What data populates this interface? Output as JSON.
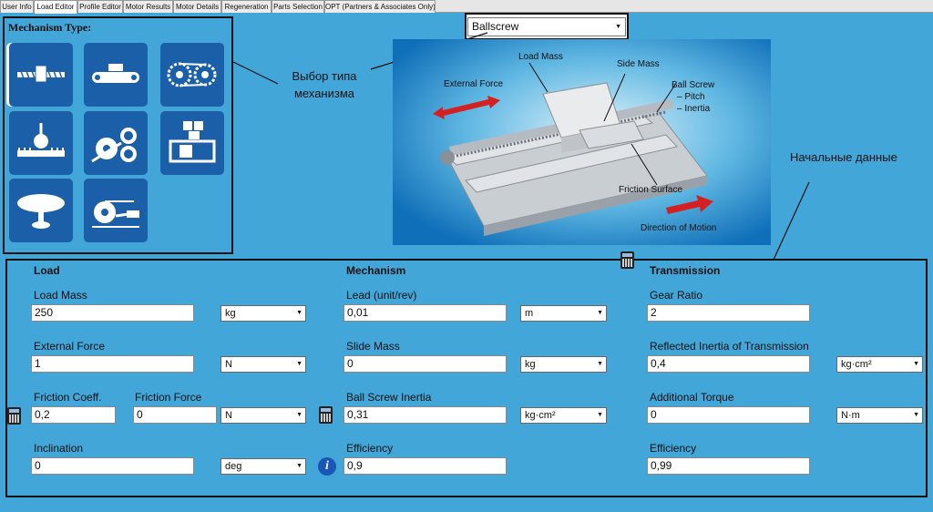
{
  "tabs": [
    {
      "label": "User Info",
      "active": false
    },
    {
      "label": "Load Editor",
      "active": true
    },
    {
      "label": "Profile Editor",
      "active": false
    },
    {
      "label": "Motor Results",
      "active": false
    },
    {
      "label": "Motor Details",
      "active": false
    },
    {
      "label": "Regeneration",
      "active": false
    },
    {
      "label": "Parts Selection",
      "active": false
    },
    {
      "label": "OPT (Partners & Associates Only)",
      "active": false
    }
  ],
  "mechanism": {
    "title": "Mechanism Type:",
    "selected": "Ballscrew",
    "types": [
      "ballscrew-icon",
      "conveyor-belt-icon",
      "chain-sprocket-icon",
      "rack-pinion-icon",
      "roll-feed-icon",
      "custom-load-icon",
      "rotary-table-icon",
      "winder-icon"
    ]
  },
  "annotations": {
    "select_type": "Выбор типа механизма",
    "initial_data": "Начальные данные"
  },
  "diagram": {
    "load_mass": "Load Mass",
    "side_mass": "Side Mass",
    "external_force": "External Force",
    "ball_screw": "Ball Screw",
    "pitch": "– Pitch",
    "inertia": "– Inertia",
    "friction_surface": "Friction Surface",
    "direction": "Direction of Motion"
  },
  "load": {
    "header": "Load",
    "load_mass": {
      "label": "Load Mass",
      "value": "250",
      "unit": "kg"
    },
    "external_force": {
      "label": "External Force",
      "value": "1",
      "unit": "N"
    },
    "friction_coeff": {
      "label": "Friction Coeff.",
      "value": "0,2"
    },
    "friction_force": {
      "label": "Friction Force",
      "value": "0",
      "unit": "N"
    },
    "inclination": {
      "label": "Inclination",
      "value": "0",
      "unit": "deg"
    }
  },
  "mech": {
    "header": "Mechanism",
    "lead": {
      "label": "Lead (unit/rev)",
      "value": "0,01",
      "unit": "m"
    },
    "slide_mass": {
      "label": "Slide Mass",
      "value": "0",
      "unit": "kg"
    },
    "ball_screw_inertia": {
      "label": "Ball Screw Inertia",
      "value": "0,31",
      "unit": "kg·cm²"
    },
    "efficiency": {
      "label": "Efficiency",
      "value": "0,9"
    }
  },
  "transmission": {
    "header": "Transmission",
    "gear_ratio": {
      "label": "Gear Ratio",
      "value": "2"
    },
    "reflected_inertia": {
      "label": "Reflected Inertia of Transmission",
      "value": "0,4",
      "unit": "kg·cm²"
    },
    "additional_torque": {
      "label": "Additional Torque",
      "value": "0",
      "unit": "N·m"
    },
    "efficiency": {
      "label": "Efficiency",
      "value": "0,99"
    }
  },
  "colors": {
    "background": "#42a6d8",
    "button": "#1a5fa7",
    "diagram_bg": "#0f6fb8",
    "arrow": "#d42020"
  }
}
